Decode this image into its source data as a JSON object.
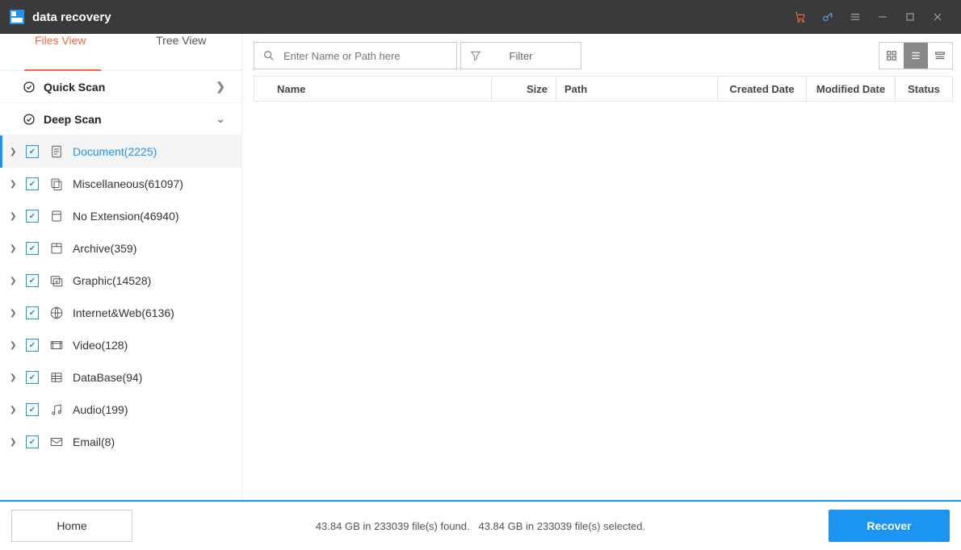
{
  "titlebar": {
    "title": "data recovery"
  },
  "sidebar": {
    "tabs": {
      "files": "Files View",
      "tree": "Tree View"
    },
    "groups": {
      "quick": "Quick Scan",
      "deep": "Deep Scan"
    },
    "categories": [
      {
        "label": "Document(2225)",
        "icon": "document",
        "active": true
      },
      {
        "label": "Miscellaneous(61097)",
        "icon": "misc"
      },
      {
        "label": "No Extension(46940)",
        "icon": "noext"
      },
      {
        "label": "Archive(359)",
        "icon": "archive"
      },
      {
        "label": "Graphic(14528)",
        "icon": "graphic"
      },
      {
        "label": "Internet&Web(6136)",
        "icon": "web"
      },
      {
        "label": "Video(128)",
        "icon": "video"
      },
      {
        "label": "DataBase(94)",
        "icon": "database"
      },
      {
        "label": "Audio(199)",
        "icon": "audio"
      },
      {
        "label": "Email(8)",
        "icon": "email"
      }
    ]
  },
  "toolbar": {
    "search_placeholder": "Enter Name or Path here",
    "filter_label": "Filter"
  },
  "table": {
    "headers": {
      "name": "Name",
      "size": "Size",
      "path": "Path",
      "cdate": "Created Date",
      "mdate": "Modified Date",
      "status": "Status"
    }
  },
  "footer": {
    "home": "Home",
    "found": "43.84 GB in 233039 file(s) found.",
    "selected": "43.84 GB in 233039 file(s) selected.",
    "recover": "Recover"
  }
}
